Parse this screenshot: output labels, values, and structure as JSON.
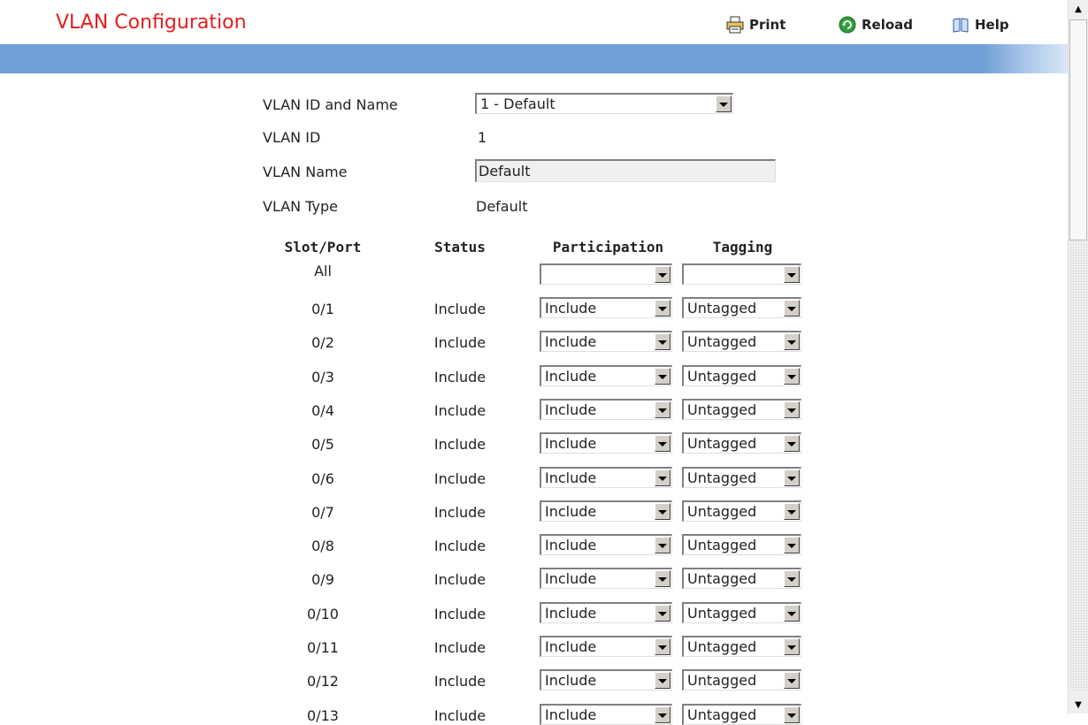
{
  "header": {
    "title": "VLAN Configuration",
    "print_label": "Print",
    "reload_label": "Reload",
    "help_label": "Help"
  },
  "colors": {
    "title": "#e31d1d",
    "bluebar": "#6f9fd6"
  },
  "form": {
    "vlan_id_and_name_label": "VLAN ID and Name",
    "vlan_id_and_name_value": "1 - Default",
    "vlan_id_label": "VLAN ID",
    "vlan_id_value": "1",
    "vlan_name_label": "VLAN Name",
    "vlan_name_value": "Default",
    "vlan_type_label": "VLAN Type",
    "vlan_type_value": "Default"
  },
  "table": {
    "headers": {
      "slot_port": "Slot/Port",
      "status": "Status",
      "participation": "Participation",
      "tagging": "Tagging"
    },
    "all_row": {
      "slot_port": "All",
      "status": "",
      "participation": "",
      "tagging": ""
    },
    "rows": [
      {
        "slot_port": "0/1",
        "status": "Include",
        "participation": "Include",
        "tagging": "Untagged"
      },
      {
        "slot_port": "0/2",
        "status": "Include",
        "participation": "Include",
        "tagging": "Untagged"
      },
      {
        "slot_port": "0/3",
        "status": "Include",
        "participation": "Include",
        "tagging": "Untagged"
      },
      {
        "slot_port": "0/4",
        "status": "Include",
        "participation": "Include",
        "tagging": "Untagged"
      },
      {
        "slot_port": "0/5",
        "status": "Include",
        "participation": "Include",
        "tagging": "Untagged"
      },
      {
        "slot_port": "0/6",
        "status": "Include",
        "participation": "Include",
        "tagging": "Untagged"
      },
      {
        "slot_port": "0/7",
        "status": "Include",
        "participation": "Include",
        "tagging": "Untagged"
      },
      {
        "slot_port": "0/8",
        "status": "Include",
        "participation": "Include",
        "tagging": "Untagged"
      },
      {
        "slot_port": "0/9",
        "status": "Include",
        "participation": "Include",
        "tagging": "Untagged"
      },
      {
        "slot_port": "0/10",
        "status": "Include",
        "participation": "Include",
        "tagging": "Untagged"
      },
      {
        "slot_port": "0/11",
        "status": "Include",
        "participation": "Include",
        "tagging": "Untagged"
      },
      {
        "slot_port": "0/12",
        "status": "Include",
        "participation": "Include",
        "tagging": "Untagged"
      },
      {
        "slot_port": "0/13",
        "status": "Include",
        "participation": "Include",
        "tagging": "Untagged"
      }
    ]
  }
}
